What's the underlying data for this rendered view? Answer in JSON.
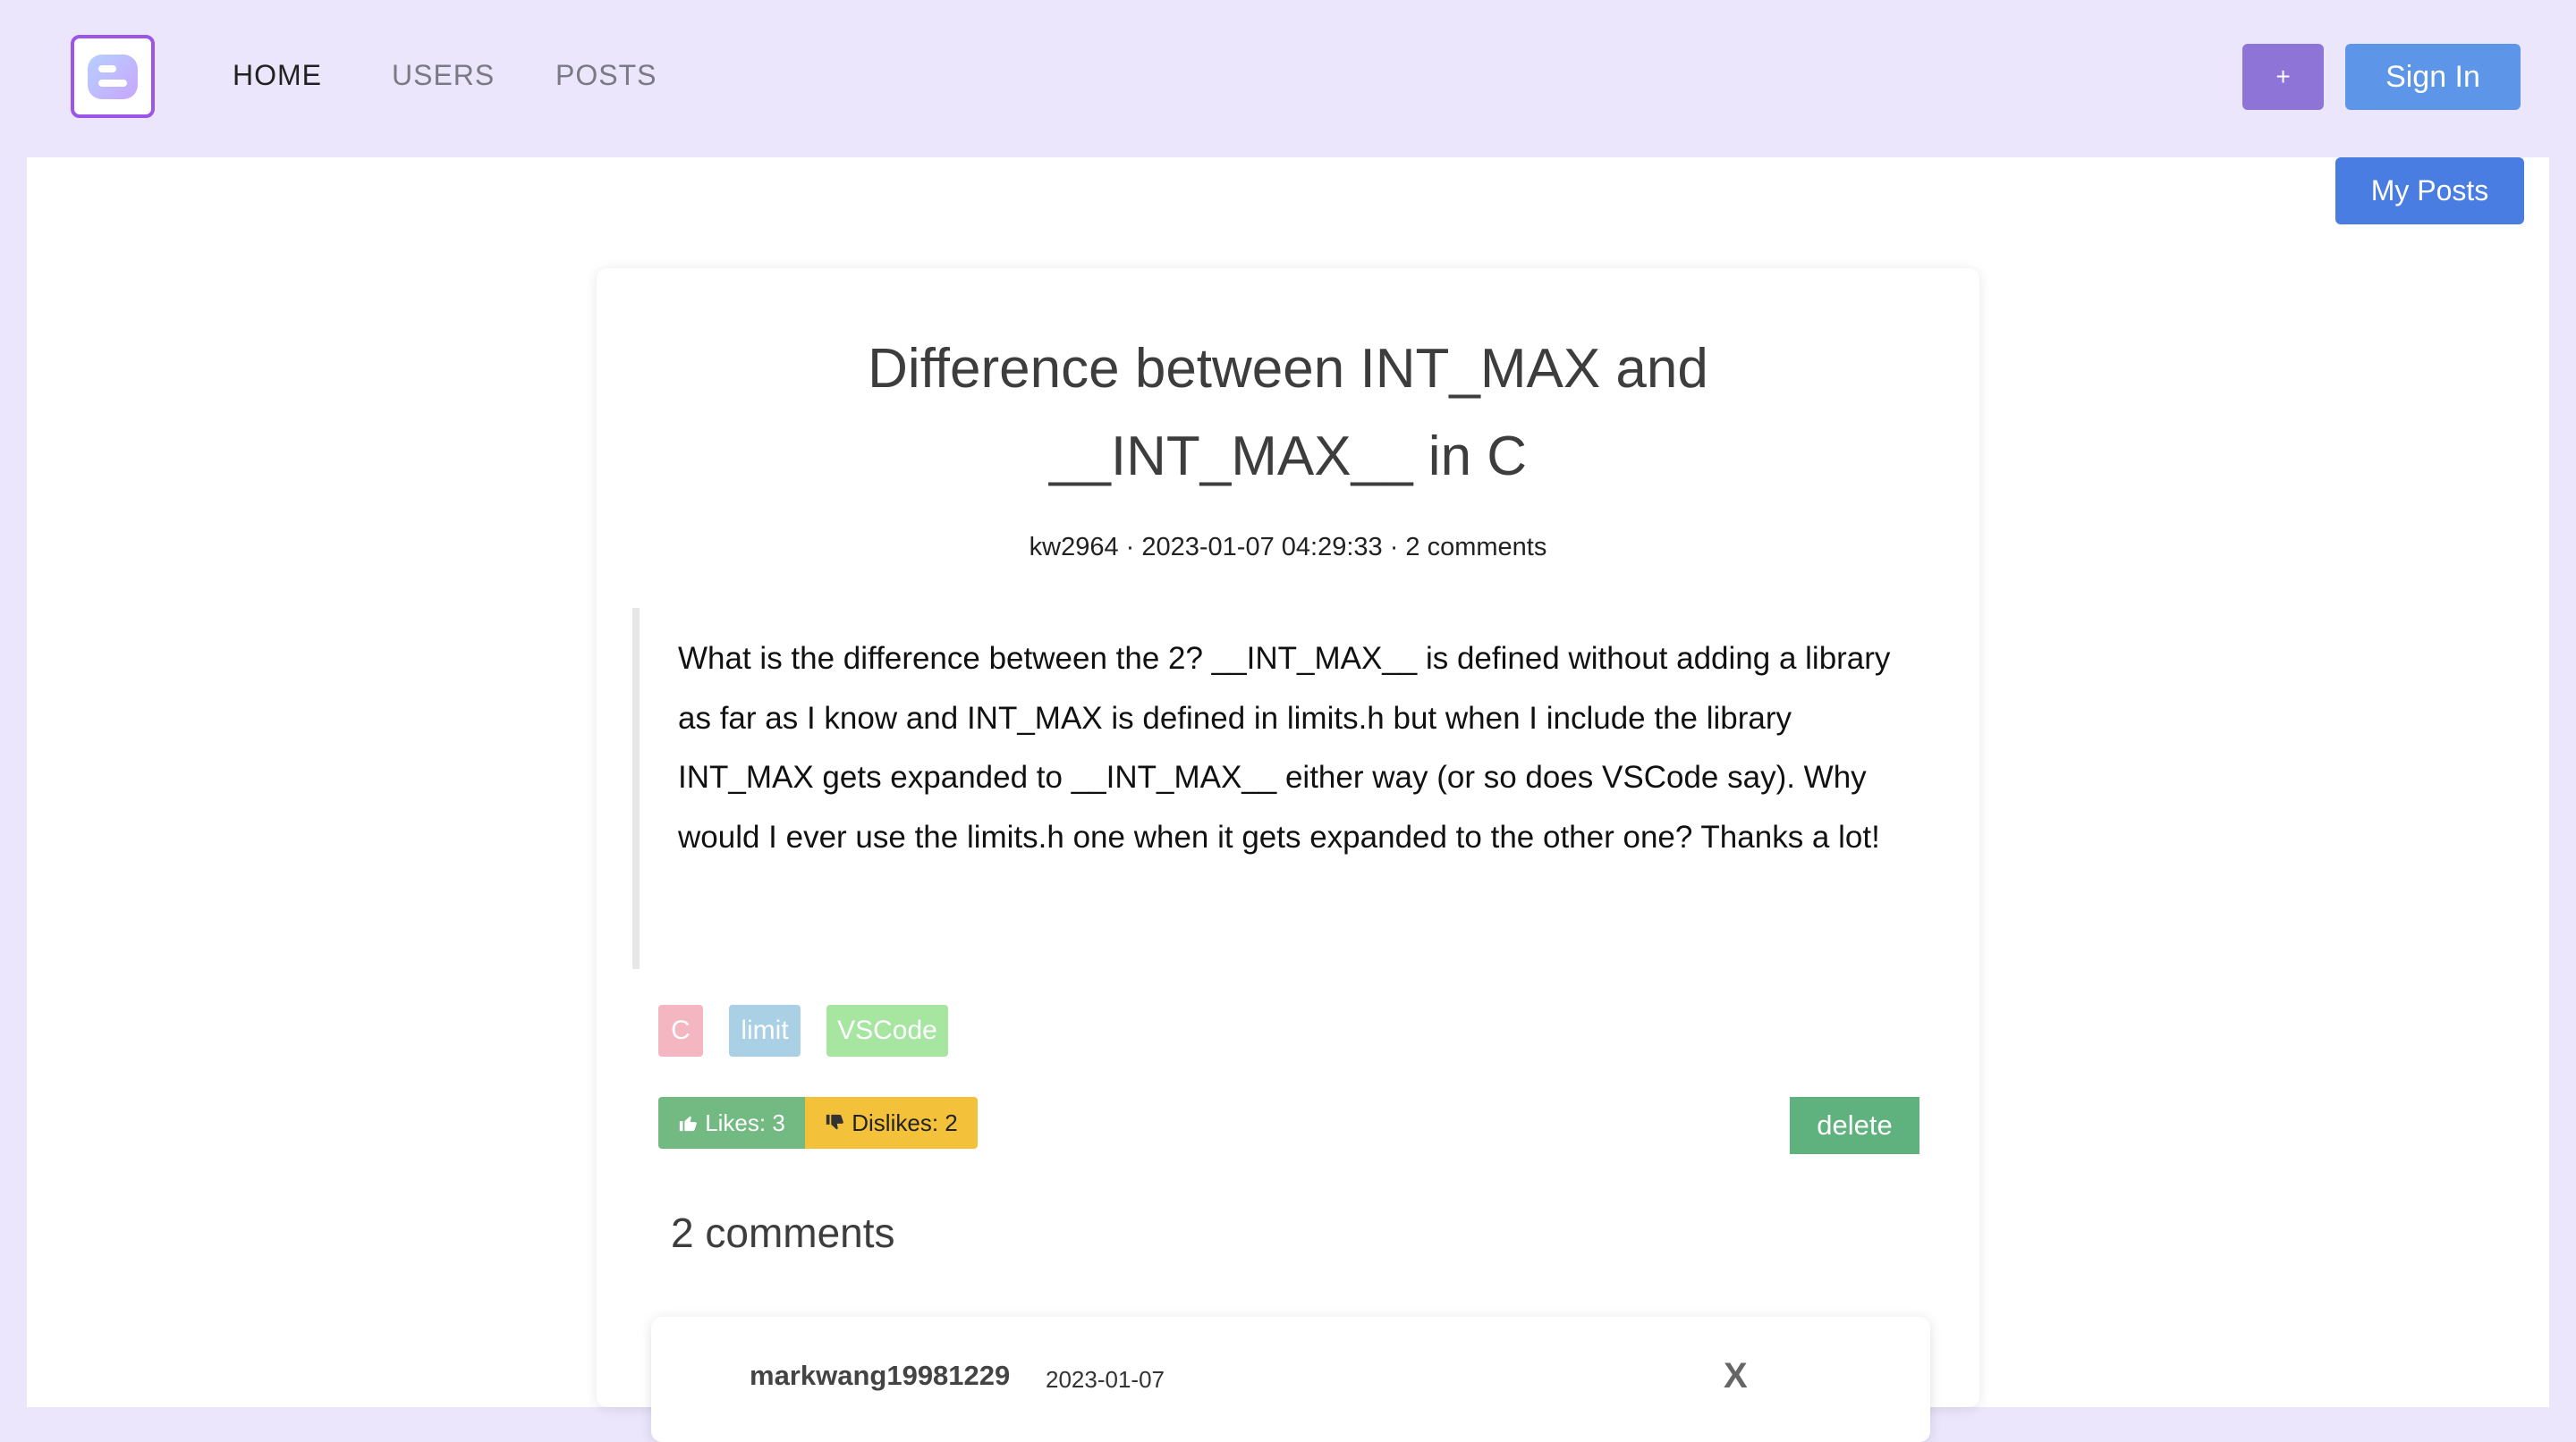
{
  "nav": {
    "logo_icon": "blog-logo-icon",
    "links": [
      {
        "label": "HOME",
        "active": true
      },
      {
        "label": "USERS",
        "active": false
      },
      {
        "label": "POSTS",
        "active": false
      }
    ],
    "plus_label": "+",
    "signin_label": "Sign In"
  },
  "my_posts_label": "My Posts",
  "post": {
    "title": "Difference between INT_MAX and __INT_MAX__ in C",
    "meta": "kw2964 · 2023-01-07 04:29:33 · 2 comments",
    "body": "What is the difference between the 2? __INT_MAX__ is defined without adding a library as far as I know and INT_MAX is defined in limits.h but when I include the library INT_MAX gets expanded to __INT_MAX__ either way (or so does VSCode say). Why would I ever use the limits.h one when it gets expanded to the other one? Thanks a lot!",
    "tags": [
      "C",
      "limit",
      "VSCode"
    ],
    "likes_label": "Likes: 3",
    "dislikes_label": "Dislikes: 2",
    "delete_label": "delete"
  },
  "comments": {
    "heading": "2 comments",
    "items": [
      {
        "author": "markwang19981229",
        "date": "2023-01-07",
        "close": "X"
      }
    ]
  },
  "colors": {
    "nav_bg": "#ebe6fc",
    "plus_button": "#8d74d6",
    "signin_button": "#5d96e8",
    "my_posts_button": "#4a7de2",
    "like": "#72b982",
    "dislike": "#f3c13a",
    "delete": "#5fb27d"
  }
}
